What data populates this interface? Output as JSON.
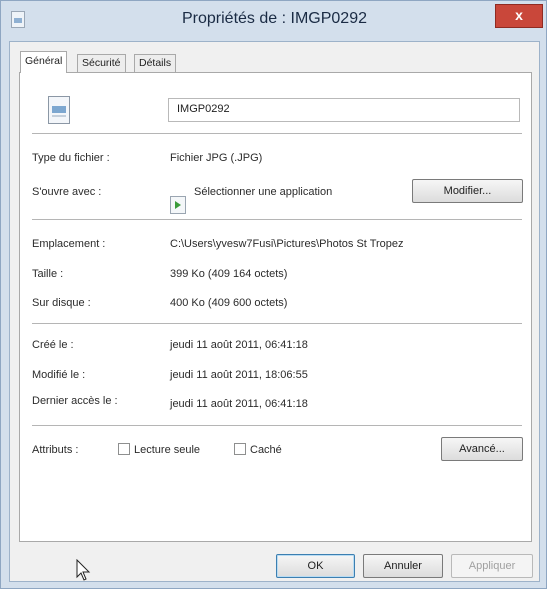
{
  "window": {
    "title": "Propriétés de : IMGP0292",
    "close_glyph": "x"
  },
  "tabs": [
    {
      "label": "Général",
      "active": true
    },
    {
      "label": "Sécurité",
      "active": false
    },
    {
      "label": "Détails",
      "active": false
    }
  ],
  "general": {
    "file_name": "IMGP0292",
    "type_label": "Type du fichier :",
    "type_value": "Fichier JPG (.JPG)",
    "opens_with_label": "S'ouvre avec :",
    "opens_with_value": "Sélectionner une application",
    "change_button": "Modifier...",
    "location_label": "Emplacement :",
    "location_value": "C:\\Users\\yvesw7Fusi\\Pictures\\Photos St Tropez",
    "size_label": "Taille :",
    "size_value": "399 Ko (409 164 octets)",
    "size_on_disk_label": "Sur disque :",
    "size_on_disk_value": "400 Ko (409 600 octets)",
    "created_label": "Créé le :",
    "created_value": "jeudi 11 août 2011, 06:41:18",
    "modified_label": "Modifié le :",
    "modified_value": "jeudi 11 août 2011, 18:06:55",
    "accessed_label": "Dernier accès le :",
    "accessed_value": "jeudi 11 août 2011, 06:41:18",
    "attributes_label": "Attributs :",
    "readonly_label": "Lecture seule",
    "readonly_checked": false,
    "hidden_label": "Caché",
    "hidden_checked": false,
    "advanced_button": "Avancé..."
  },
  "footer": {
    "ok_button": "OK",
    "cancel_button": "Annuler",
    "apply_button": "Appliquer",
    "apply_enabled": false
  },
  "icons": [
    "app-icon",
    "close-icon",
    "file-icon",
    "application-icon",
    "mouse-cursor-icon"
  ],
  "colors": {
    "frame": "#d3dfec",
    "close": "#c9473a",
    "client": "#f0f0f0",
    "default_button_border": "#3c7fb1"
  }
}
